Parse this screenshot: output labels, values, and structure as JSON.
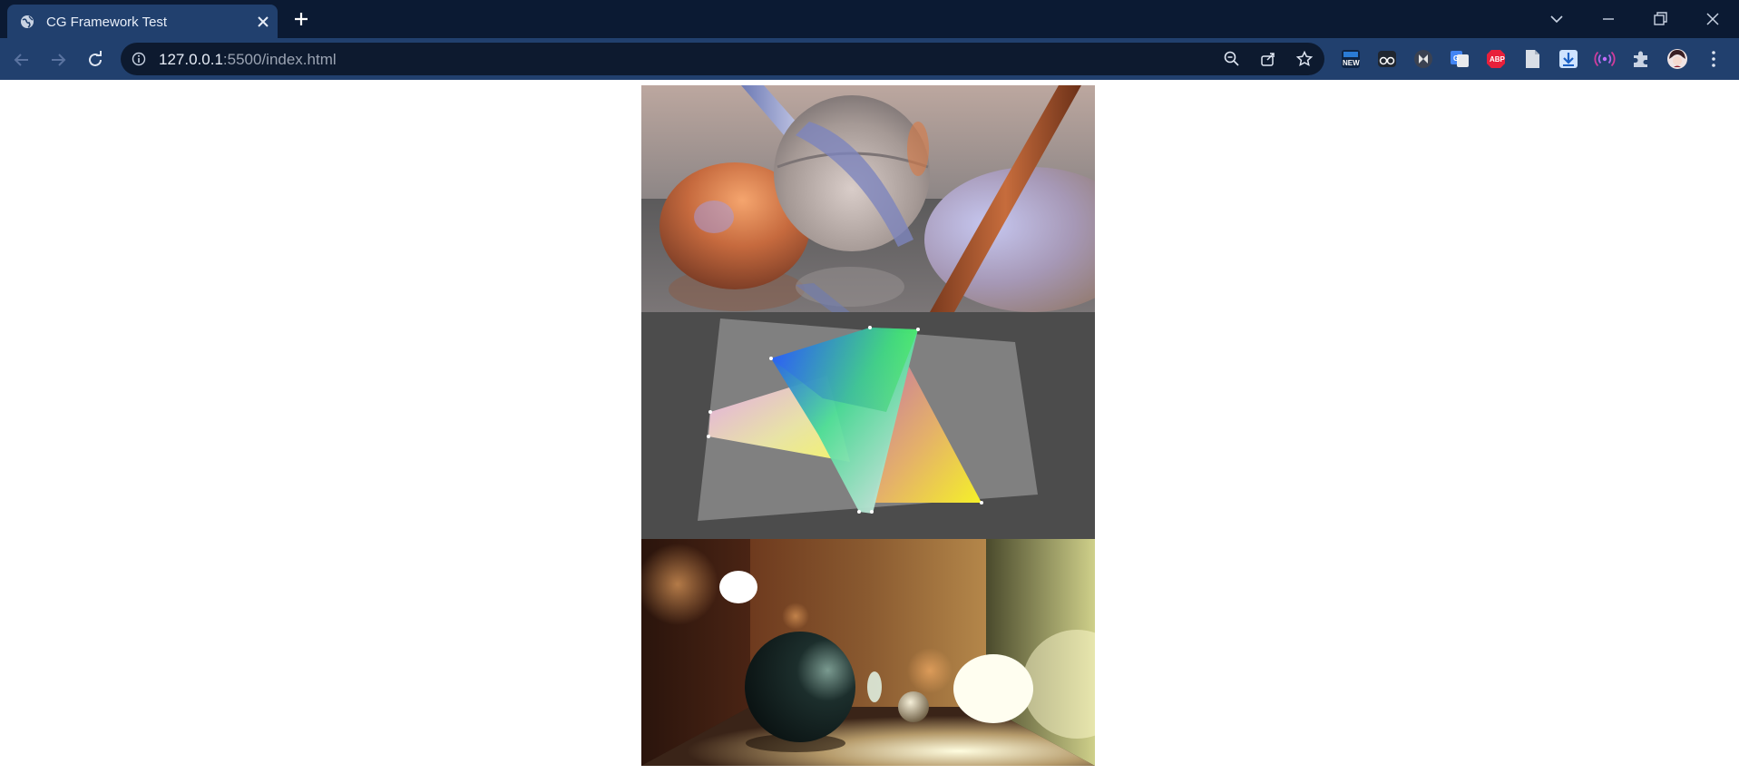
{
  "browser": {
    "tab": {
      "title": "CG Framework Test"
    },
    "url": {
      "host": "127.0.0.1",
      "rest": ":5500/index.html"
    }
  },
  "icons": {
    "favicon": "globe-icon",
    "extensions": [
      "new-badge-extension-icon",
      "glasses-extension-icon",
      "media-extension-icon",
      "translate-extension-icon",
      "adblock-extension-icon",
      "document-extension-icon",
      "download-extension-icon",
      "broadcast-extension-icon",
      "puzzle-extension-icon",
      "profile-avatar-icon",
      "menu-dots-icon"
    ]
  },
  "extension_labels": {
    "new": "NEW",
    "abp": "ABP"
  },
  "colors": {
    "titlebar": "#0b1a33",
    "toolbar": "#21406e",
    "omnibox": "#0d1a2f"
  },
  "canvases": [
    {
      "name": "raytraced-glass-spheres"
    },
    {
      "name": "rasterized-color-triangles"
    },
    {
      "name": "path-traced-cornell-box"
    }
  ]
}
